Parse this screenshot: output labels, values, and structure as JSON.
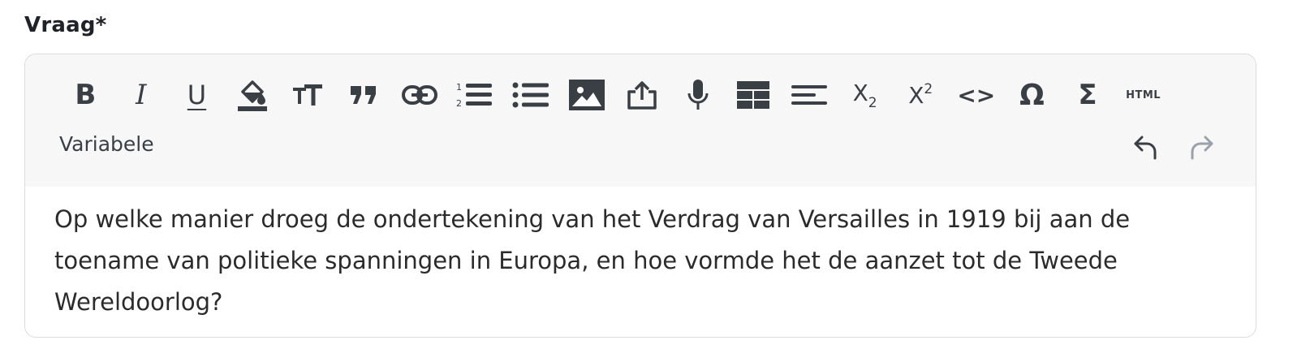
{
  "field": {
    "label": "Vraag*"
  },
  "toolbar": {
    "bold_label": "B",
    "italic_label": "I",
    "underline_label": "U",
    "subscript_base": "X",
    "subscript_digit": "2",
    "superscript_base": "X",
    "superscript_digit": "2",
    "code_label": "<>",
    "special_char_label": "Ω",
    "formula_label": "Σ",
    "html_label": "HTML",
    "variable_label": "Variabele",
    "icons": [
      "bold",
      "italic",
      "underline",
      "fill-color-icon",
      "font-size-icon",
      "quote-icon",
      "link-icon",
      "ordered-list-icon",
      "unordered-list-icon",
      "image-icon",
      "upload-icon",
      "microphone-icon",
      "table-icon",
      "align-icon",
      "subscript",
      "superscript",
      "code-icon",
      "omega-icon",
      "sigma-icon",
      "html-icon",
      "undo-icon",
      "redo-icon"
    ],
    "colors": {
      "icon": "#3a3f45",
      "disabled": "#9aa1a8",
      "toolbar_bg": "#f7f7f7"
    }
  },
  "editor": {
    "content": "Op welke manier droeg de ondertekening van het Verdrag van Versailles in 1919 bij aan de toename van politieke spanningen in Europa, en hoe vormde het de aanzet tot de Tweede Wereldoorlog?"
  }
}
